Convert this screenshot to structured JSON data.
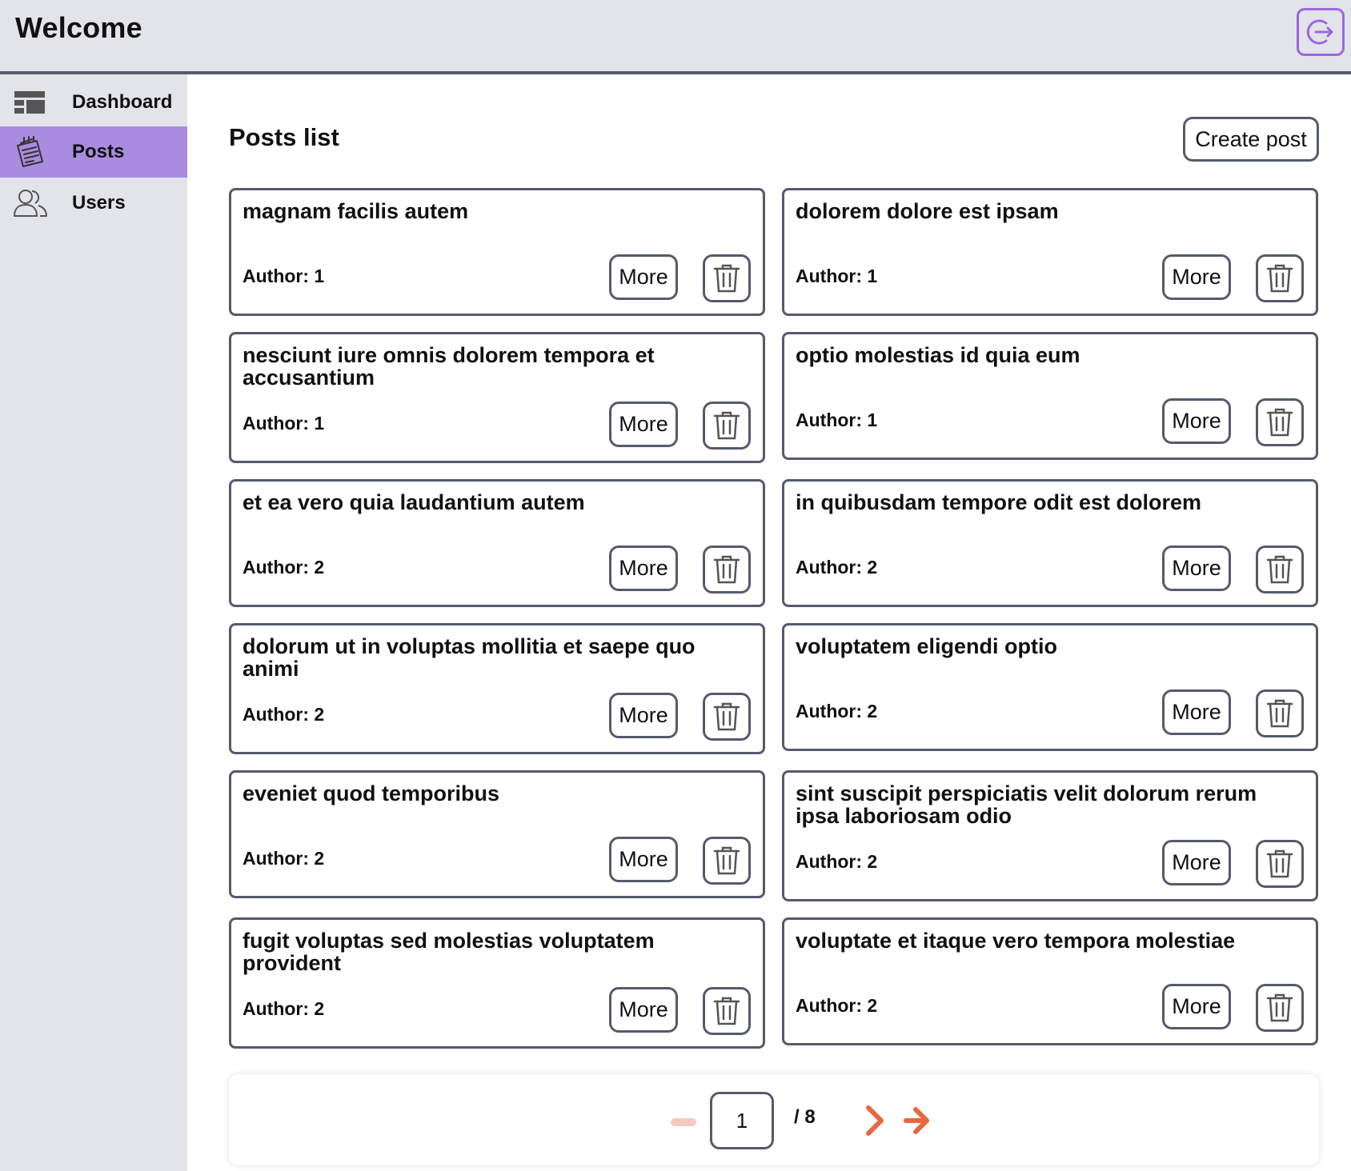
{
  "header": {
    "title": "Welcome",
    "logout_icon": "logout-icon",
    "accent": "#9b66e6"
  },
  "sidebar": {
    "items": [
      {
        "label": "Dashboard",
        "icon": "dashboard-icon",
        "active": false
      },
      {
        "label": "Posts",
        "icon": "posts-icon",
        "active": true
      },
      {
        "label": "Users",
        "icon": "users-icon",
        "active": false
      }
    ],
    "active_color": "#a98ce0"
  },
  "main": {
    "title": "Posts list",
    "create_label": "Create post",
    "posts": [
      {
        "title": "magnam facilis autem",
        "author": "Author: 1",
        "more": "More"
      },
      {
        "title": "dolorem dolore est ipsam",
        "author": "Author: 1",
        "more": "More"
      },
      {
        "title": "nesciunt iure omnis dolorem tempora et accusantium",
        "author": "Author: 1",
        "more": "More"
      },
      {
        "title": "optio molestias id quia eum",
        "author": "Author: 1",
        "more": "More"
      },
      {
        "title": "et ea vero quia laudantium autem",
        "author": "Author: 2",
        "more": "More"
      },
      {
        "title": "in quibusdam tempore odit est dolorem",
        "author": "Author: 2",
        "more": "More"
      },
      {
        "title": "dolorum ut in voluptas mollitia et saepe quo animi",
        "author": "Author: 2",
        "more": "More"
      },
      {
        "title": "voluptatem eligendi optio",
        "author": "Author: 2",
        "more": "More"
      },
      {
        "title": "eveniet quod temporibus",
        "author": "Author: 2",
        "more": "More"
      },
      {
        "title": "sint suscipit perspiciatis velit dolorum rerum ipsa laboriosam odio",
        "author": "Author: 2",
        "more": "More"
      },
      {
        "title": "fugit voluptas sed molestias voluptatem provident",
        "author": "Author: 2",
        "more": "More"
      },
      {
        "title": "voluptate et itaque vero tempora molestiae",
        "author": "Author: 2",
        "more": "More"
      }
    ]
  },
  "pagination": {
    "current_page": "1",
    "total": "/ 8",
    "prev_icon": "minus-icon",
    "next_icon": "chevron-right-icon",
    "last_icon": "arrow-right-icon",
    "arrow_color": "#e8683e"
  }
}
